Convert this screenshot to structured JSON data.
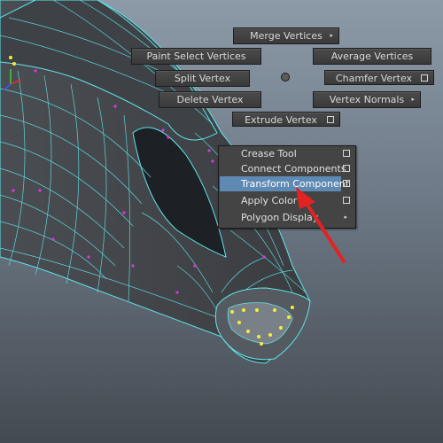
{
  "marking_menu": {
    "north": {
      "label": "Merge Vertices",
      "option": "arrow"
    },
    "north_west": {
      "label": "Paint Select Vertices"
    },
    "north_east": {
      "label": "Average Vertices"
    },
    "west": {
      "label": "Split Vertex"
    },
    "east": {
      "label": "Chamfer Vertex",
      "option": "box"
    },
    "south_west": {
      "label": "Delete Vertex"
    },
    "south_east": {
      "label": "Vertex Normals",
      "option": "arrow"
    },
    "south": {
      "label": "Extrude Vertex",
      "option": "box"
    }
  },
  "overflow_menu": {
    "items": [
      {
        "label": "Crease Tool",
        "option": "box",
        "highlighted": false
      },
      {
        "label": "Connect Components",
        "option": "box",
        "highlighted": false
      },
      {
        "label": "Transform Component",
        "option": "box",
        "highlighted": true
      },
      {
        "label": "Apply Color",
        "option": "box",
        "highlighted": false
      },
      {
        "label": "Polygon Display",
        "option": "arrow",
        "highlighted": false
      }
    ]
  },
  "glyphs": {
    "arrow": "▸"
  },
  "colors": {
    "wireframe": "#5fe6ea",
    "vertex_selected": "#f5ef3a",
    "vertex_magenta": "#d63cdc",
    "highlight": "#5e89b3",
    "annotation_arrow": "#e32222"
  }
}
